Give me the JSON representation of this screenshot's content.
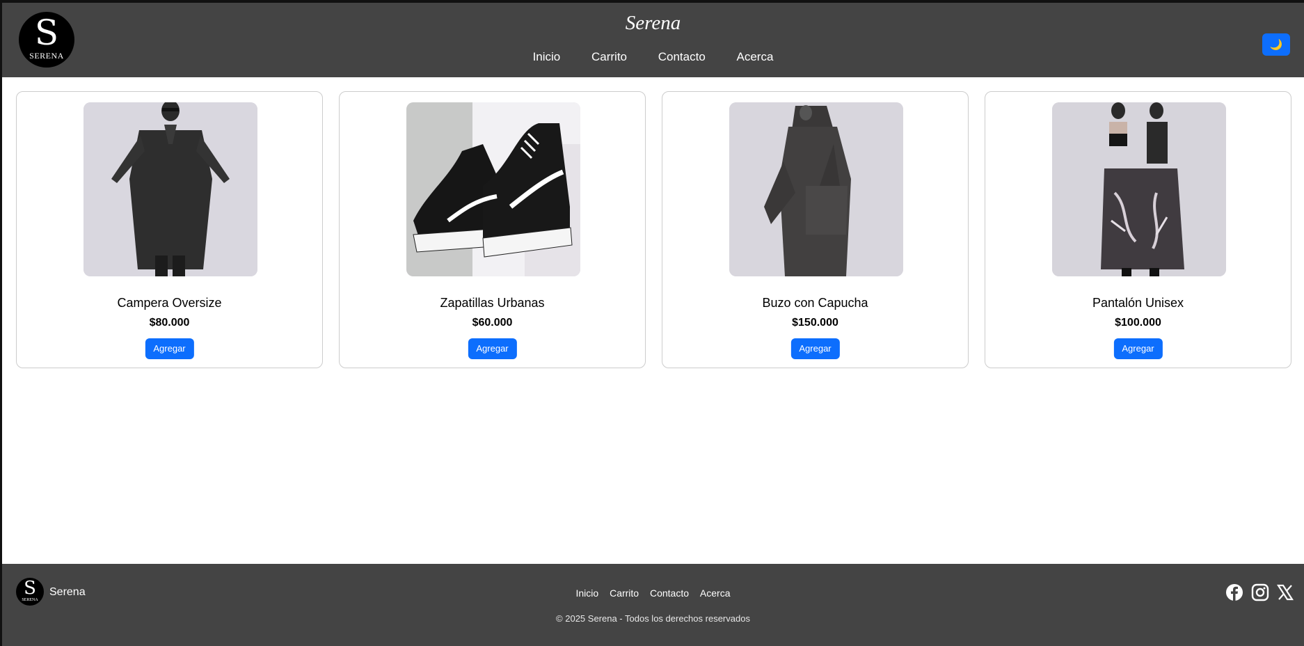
{
  "header": {
    "logo_letter": "S",
    "logo_word": "SERENA",
    "title": "Serena",
    "nav": [
      "Inicio",
      "Carrito",
      "Contacto",
      "Acerca"
    ],
    "theme_toggle_icon": "🌙"
  },
  "products": [
    {
      "name": "Campera Oversize",
      "price": "$80.000",
      "button": "Agregar",
      "image": "black-oversize-coat"
    },
    {
      "name": "Zapatillas Urbanas",
      "price": "$60.000",
      "button": "Agregar",
      "image": "black-white-sneakers"
    },
    {
      "name": "Buzo con Capucha",
      "price": "$150.000",
      "button": "Agregar",
      "image": "grey-hooded-robe"
    },
    {
      "name": "Pantalón Unisex",
      "price": "$100.000",
      "button": "Agregar",
      "image": "wide-printed-pants"
    }
  ],
  "footer": {
    "logo_letter": "S",
    "logo_word": "SERENA",
    "brand": "Serena",
    "nav": [
      "Inicio",
      "Carrito",
      "Contacto",
      "Acerca"
    ],
    "copyright": "© 2025 Serena - Todos los derechos reservados",
    "social": [
      "facebook-icon",
      "instagram-icon",
      "x-icon"
    ]
  },
  "colors": {
    "header_bg": "#444444",
    "accent": "#0d6efd",
    "card_border": "#cccccc"
  }
}
